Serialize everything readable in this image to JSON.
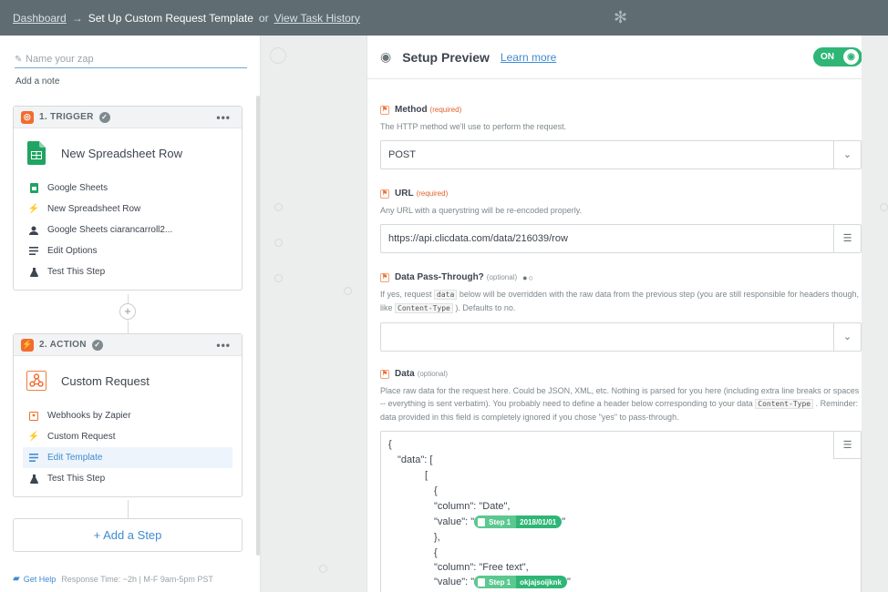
{
  "topbar": {
    "dashboard": "Dashboard",
    "arrow": "→",
    "title": "Set Up Custom Request Template",
    "or": "or",
    "history": "View Task History"
  },
  "left": {
    "zap_name_placeholder": "Name your zap",
    "add_note": "Add a note",
    "trigger": {
      "header": "1. TRIGGER",
      "title": "New Spreadsheet Row",
      "steps": [
        {
          "label": "Google Sheets",
          "icon": "google-sheets-icon"
        },
        {
          "label": "New Spreadsheet Row",
          "icon": "bolt-icon"
        },
        {
          "label": "Google Sheets ciarancarroll2...",
          "icon": "user-icon"
        },
        {
          "label": "Edit Options",
          "icon": "list-icon"
        },
        {
          "label": "Test This Step",
          "icon": "flask-icon"
        }
      ]
    },
    "action": {
      "header": "2. ACTION",
      "title": "Custom Request",
      "steps": [
        {
          "label": "Webhooks by Zapier",
          "icon": "webhook-icon"
        },
        {
          "label": "Custom Request",
          "icon": "bolt-icon"
        },
        {
          "label": "Edit Template",
          "icon": "list-icon",
          "active": true
        },
        {
          "label": "Test This Step",
          "icon": "flask-icon"
        }
      ]
    },
    "add_step": "+ Add a Step",
    "footer": {
      "help": "Get Help",
      "response": "Response Time: ~2h | M-F 9am-5pm PST"
    }
  },
  "preview": {
    "title": "Setup Preview",
    "learn_more": "Learn more",
    "toggle": "ON"
  },
  "fields": {
    "method": {
      "label": "Method",
      "req": "(required)",
      "help": "The HTTP method we'll use to perform the request.",
      "value": "POST"
    },
    "url": {
      "label": "URL",
      "req": "(required)",
      "help": "Any URL with a querystring will be re-encoded properly.",
      "value": "https://api.clicdata.com/data/216039/row"
    },
    "passthrough": {
      "label": "Data Pass-Through?",
      "opt": "(optional)",
      "help_1": "If yes, request",
      "code_1": "data",
      "help_2": "below will be overridden with the raw data from the previous step (you are still responsible for headers though, like",
      "code_2": "Content-Type",
      "help_3": "). Defaults to no.",
      "value": ""
    },
    "data": {
      "label": "Data",
      "opt": "(optional)",
      "help_1": "Place raw data for the request here. Could be JSON, XML, etc. Nothing is parsed for you here (including extra line breaks or spaces -- everything is sent verbatim). You probably need to define a header below corresponding to your data",
      "code_1": "Content-Type",
      "help_2": ". Reminder: data provided in this field is completely ignored if you chose \"yes\" to pass-through.",
      "lines": {
        "l1": "{",
        "l2": "\"data\": [",
        "l3": "[",
        "l4": "{",
        "l5": "\"column\": \"Date\",",
        "l6_pre": "\"value\": \"",
        "l6_step": "Step 1",
        "l6_val": "2018/01/01",
        "l6_post": "\"",
        "l7": "},",
        "l8": "{",
        "l9": "\"column\": \"Free text\",",
        "l10_pre": "\"value\": \"",
        "l10_step": "Step 1",
        "l10_val": "okjajsoijknk",
        "l10_post": "\""
      }
    }
  }
}
